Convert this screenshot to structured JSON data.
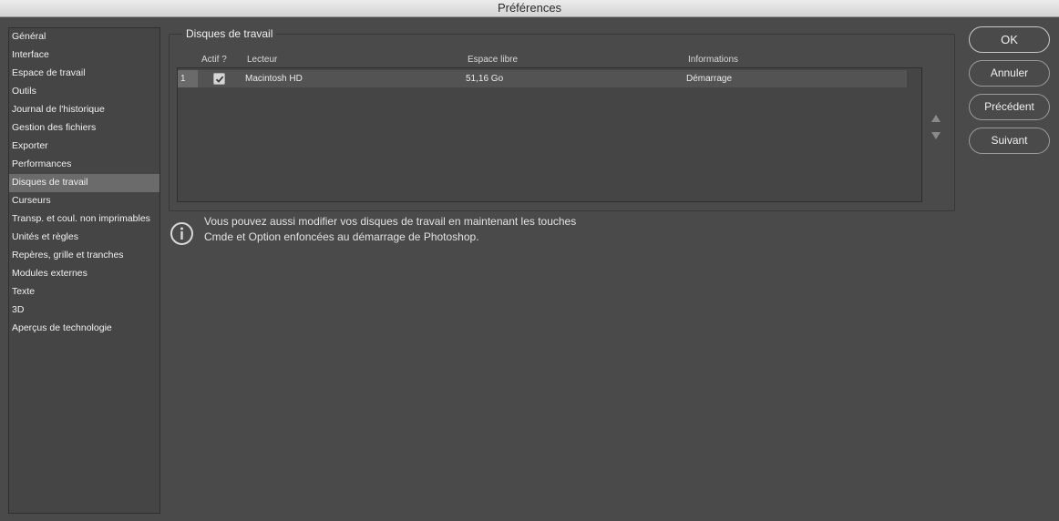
{
  "window": {
    "title": "Préférences"
  },
  "sidebar": {
    "items": [
      {
        "label": "Général"
      },
      {
        "label": "Interface"
      },
      {
        "label": "Espace de travail"
      },
      {
        "label": "Outils"
      },
      {
        "label": "Journal de l'historique"
      },
      {
        "label": "Gestion des fichiers"
      },
      {
        "label": "Exporter"
      },
      {
        "label": "Performances"
      },
      {
        "label": "Disques de travail",
        "selected": true
      },
      {
        "label": "Curseurs"
      },
      {
        "label": "Transp. et coul. non imprimables"
      },
      {
        "label": "Unités et règles"
      },
      {
        "label": "Repères, grille et tranches"
      },
      {
        "label": "Modules externes"
      },
      {
        "label": "Texte"
      },
      {
        "label": "3D"
      },
      {
        "label": "Aperçus de technologie"
      }
    ]
  },
  "scratch": {
    "title": "Disques de travail",
    "columns": {
      "active": "Actif ?",
      "drive": "Lecteur",
      "free": "Espace libre",
      "info": "Informations"
    },
    "rows": [
      {
        "index": "1",
        "active": true,
        "drive": "Macintosh HD",
        "free": "51,16 Go",
        "info": "Démarrage"
      }
    ]
  },
  "info": {
    "icon": "info-icon",
    "line1": "Vous pouvez aussi modifier vos disques de travail en maintenant les touches",
    "line2": "Cmde et Option enfoncées au démarrage de Photoshop."
  },
  "buttons": {
    "ok": "OK",
    "cancel": "Annuler",
    "previous": "Précédent",
    "next": "Suivant"
  },
  "colors": {
    "background": "#4a4a4a",
    "selection": "#6b6b6b"
  }
}
